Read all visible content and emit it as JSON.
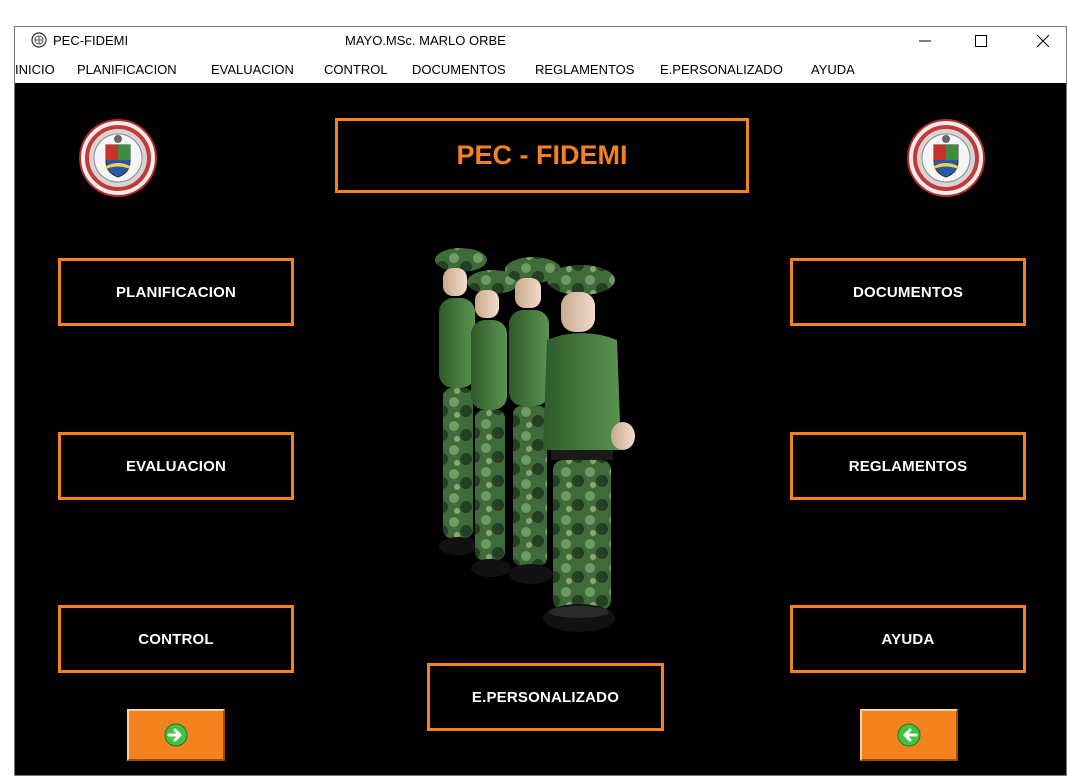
{
  "window": {
    "app_title": "PEC-FIDEMI",
    "caption": "MAYO.MSc. MARLO ORBE"
  },
  "menu": [
    "INICIO",
    "PLANIFICACION",
    "EVALUACION",
    "CONTROL",
    "DOCUMENTOS",
    "REGLAMENTOS",
    "E.PERSONALIZADO",
    "AYUDA"
  ],
  "main": {
    "title": "PEC - FIDEMI",
    "buttons": {
      "planificacion": "PLANIFICACION",
      "evaluacion": "EVALUACION",
      "control": "CONTROL",
      "documentos": "DOCUMENTOS",
      "reglamentos": "REGLAMENTOS",
      "ayuda": "AYUDA",
      "e_personalizado": "E.PERSONALIZADO"
    },
    "icons": {
      "seal_left": "seal-emblem-icon",
      "seal_right": "seal-emblem-icon",
      "next": "arrow-right-icon",
      "back": "arrow-left-icon"
    }
  },
  "colors": {
    "accent": "#f4831f",
    "background": "#000000",
    "arrow_circle": "#3ec43e"
  }
}
